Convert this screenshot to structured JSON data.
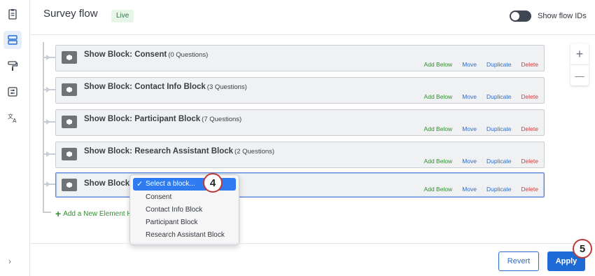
{
  "header": {
    "title": "Survey flow",
    "status_badge": "Live",
    "toggle_label": "Show flow IDs"
  },
  "rail": {
    "icons": [
      "survey-icon",
      "flow-icon",
      "paint-roller-icon",
      "options-icon",
      "translate-icon"
    ],
    "expand": "›"
  },
  "blocks": [
    {
      "title": "Show Block: Consent",
      "count": "(0 Questions)"
    },
    {
      "title": "Show Block: Contact Info Block",
      "count": "(3 Questions)"
    },
    {
      "title": "Show Block: Participant Block",
      "count": "(7 Questions)"
    },
    {
      "title": "Show Block: Research Assistant Block",
      "count": "(2 Questions)"
    },
    {
      "title": "Show Block",
      "count": ""
    }
  ],
  "actions": {
    "add_below": "Add Below",
    "move": "Move",
    "duplicate": "Duplicate",
    "delete": "Delete"
  },
  "add_element": {
    "plus": "+",
    "label": "Add a New Element H"
  },
  "zoom": {
    "in": "+",
    "out": "—"
  },
  "dropdown": {
    "selected": "Select a block...",
    "options": [
      "Consent",
      "Contact Info Block",
      "Participant Block",
      "Research Assistant Block"
    ]
  },
  "markers": [
    "4",
    "5"
  ],
  "footer": {
    "revert": "Revert",
    "apply": "Apply"
  },
  "colors": {
    "accent": "#1e6bd6",
    "add": "#2f8f2f",
    "delete": "#d23b3b",
    "marker_border": "#c13a3a"
  }
}
